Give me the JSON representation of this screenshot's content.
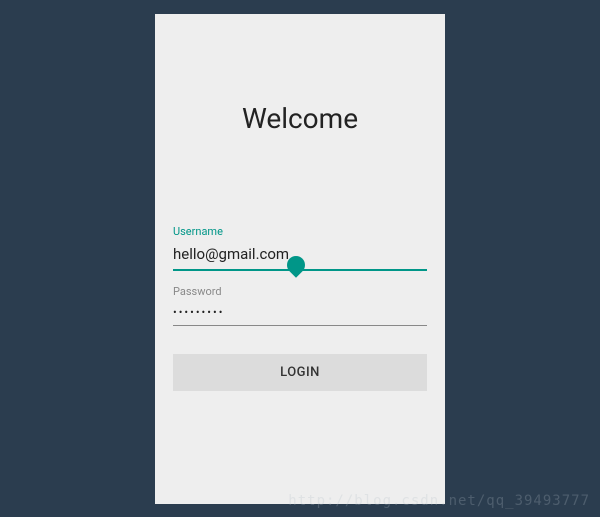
{
  "title": "Welcome",
  "fields": {
    "username": {
      "label": "Username",
      "value": "hello@gmail.com"
    },
    "password": {
      "label": "Password",
      "value": "•••••••••"
    }
  },
  "buttons": {
    "login": "LOGIN"
  },
  "colors": {
    "accent": "#009688",
    "background": "#eeeeee",
    "page_bg": "#2b3d4f"
  },
  "watermark": "http://blog.csdn.net/qq_39493777"
}
